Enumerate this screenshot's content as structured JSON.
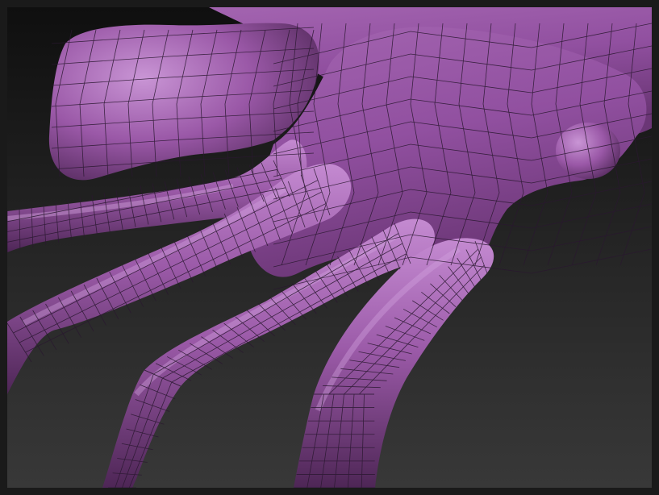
{
  "viewport": {
    "background_top": "#0f0f0f",
    "background_bottom": "#383838"
  },
  "model": {
    "base_color": "#9a57a6",
    "highlight_color": "#c98fd6",
    "shadow_color": "#4f2758",
    "wire_color": "#2a1830"
  }
}
